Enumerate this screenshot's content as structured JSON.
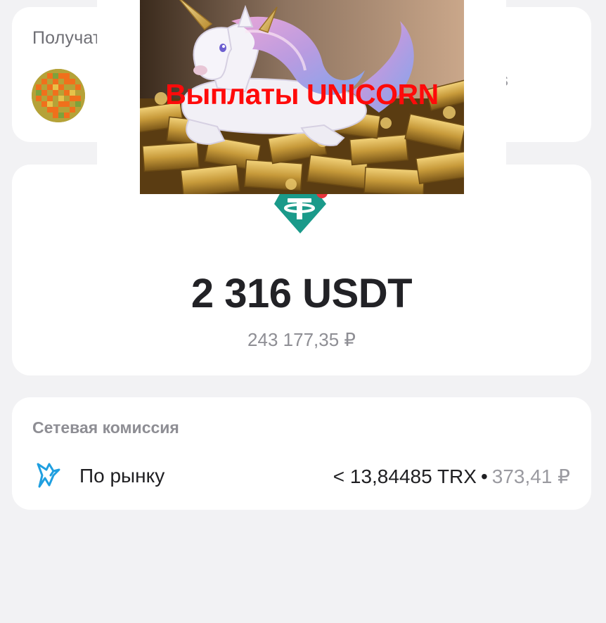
{
  "recipient": {
    "label": "Получатель",
    "trailing_text": "s"
  },
  "transfer": {
    "token_icon": "tether-usdt-icon",
    "amount": "2 316 USDT",
    "fiat_equivalent": "243 177,35 ₽"
  },
  "fee": {
    "title": "Сетевая комиссия",
    "icon": "hummingbird-icon",
    "speed_label": "По рынку",
    "crypto_value": "< 13,84485 TRX",
    "separator": "•",
    "fiat_value": "373,41 ₽"
  },
  "promo": {
    "caption": "Выплаты UNICORN"
  },
  "colors": {
    "background": "#f2f2f4",
    "card": "#ffffff",
    "tether_green": "#1a9a8a",
    "badge_red": "#e8333b",
    "hummingbird_blue": "#1f9fe0",
    "promo_caption": "#ff0a0a"
  }
}
